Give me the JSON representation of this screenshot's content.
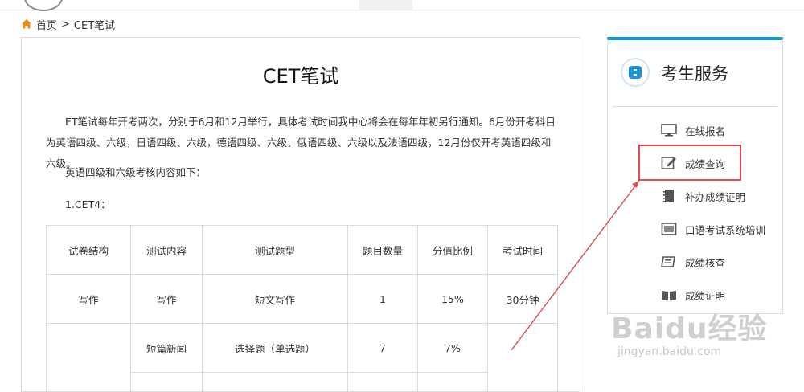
{
  "breadcrumb": {
    "home": "首页",
    "separator": ">",
    "current": "CET笔试"
  },
  "article": {
    "title": "CET笔试",
    "paragraph1": "ET笔试每年开考两次，分别于6月和12月举行，具体考试时间我中心将会在每年年初另行通知。6月份开考科目为英语四级、六级，日语四级、六级，德语四级、六级、俄语四级、六级以及法语四级，12月份仅开考英语四级和六级。",
    "paragraph2": "英语四级和六级考核内容如下：",
    "section": "1.CET4："
  },
  "table": {
    "headers": [
      "试卷结构",
      "测试内容",
      "测试题型",
      "题目数量",
      "分值比例",
      "考试时间"
    ],
    "rows": [
      [
        "写作",
        "写作",
        "短文写作",
        "1",
        "15%",
        "30分钟"
      ],
      [
        "",
        "短篇新闻",
        "选择题（单选题）",
        "7",
        "7%",
        ""
      ]
    ]
  },
  "sidebar": {
    "title": "考生服务",
    "items": [
      {
        "label": "在线报名",
        "icon": "monitor-icon"
      },
      {
        "label": "成绩查询",
        "icon": "edit-icon"
      },
      {
        "label": "补办成绩证明",
        "icon": "notebook-icon"
      },
      {
        "label": "口语考试系统培训",
        "icon": "window-icon"
      },
      {
        "label": "成绩核查",
        "icon": "book-icon"
      },
      {
        "label": "成绩证明",
        "icon": "open-book-icon"
      }
    ]
  },
  "watermark": {
    "brand": "Baidu经验",
    "url": "jingyan.baidu.com"
  },
  "colors": {
    "accent": "#1a96d6",
    "highlight": "#e04b4b",
    "home_icon": "#f08a16"
  }
}
